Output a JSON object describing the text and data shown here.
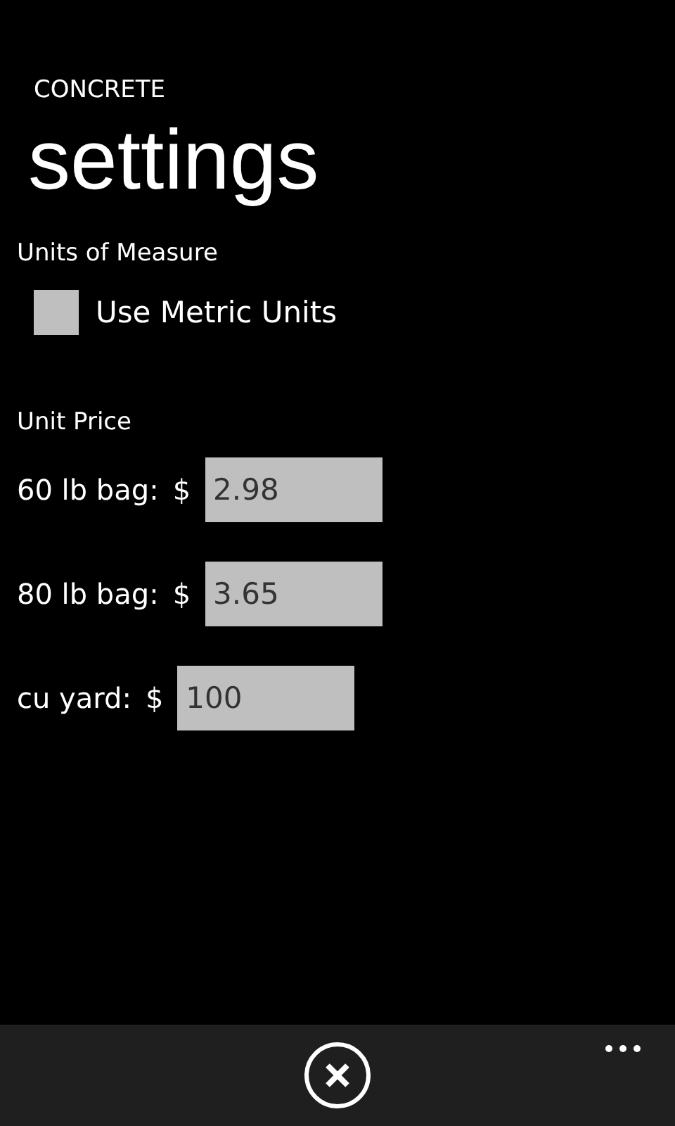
{
  "app_title": "CONCRETE",
  "page_title": "settings",
  "units_section": {
    "heading": "Units of Measure",
    "checkbox": {
      "label": "Use Metric Units",
      "checked": false
    }
  },
  "price_section": {
    "heading": "Unit Price",
    "fields": [
      {
        "label": "60 lb bag:",
        "currency": "$",
        "value": "2.98"
      },
      {
        "label": "80 lb bag:",
        "currency": "$",
        "value": "3.65"
      },
      {
        "label": "cu yard:",
        "currency": "$",
        "value": "100"
      }
    ]
  },
  "app_bar": {
    "buttons": [
      {
        "kind": "cancel"
      }
    ],
    "menu": {
      "kind": "more"
    }
  }
}
